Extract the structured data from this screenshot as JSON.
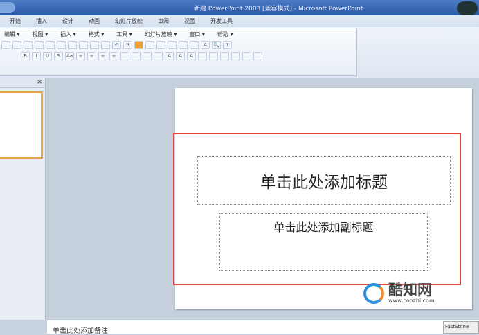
{
  "window": {
    "title": "新建 PowerPoint 2003 [兼容模式] - Microsoft PowerPoint"
  },
  "tabs": [
    "开始",
    "插入",
    "设计",
    "动画",
    "幻灯片放映",
    "审阅",
    "视图",
    "开发工具"
  ],
  "menu": [
    "编辑 ▾",
    "视图 ▾",
    "插入 ▾",
    "格式 ▾",
    "工具 ▾",
    "幻灯片放映 ▾",
    "窗口 ▾",
    "帮助 ▾"
  ],
  "format_buttons": [
    "B",
    "I",
    "U",
    "S",
    "Aa",
    "A",
    "A",
    "A"
  ],
  "panel": {
    "close": "×"
  },
  "slide": {
    "title_placeholder": "单击此处添加标题",
    "subtitle_placeholder": "单击此处添加副标题"
  },
  "notes": {
    "placeholder": "单击此处添加备注"
  },
  "watermark": {
    "name": "酷知网",
    "url": "www.coozhi.com"
  },
  "taskbar": {
    "faststone": "FastStone"
  },
  "colors": {
    "highlight": "#e0443f",
    "titlebar": "#2a5aa8"
  }
}
